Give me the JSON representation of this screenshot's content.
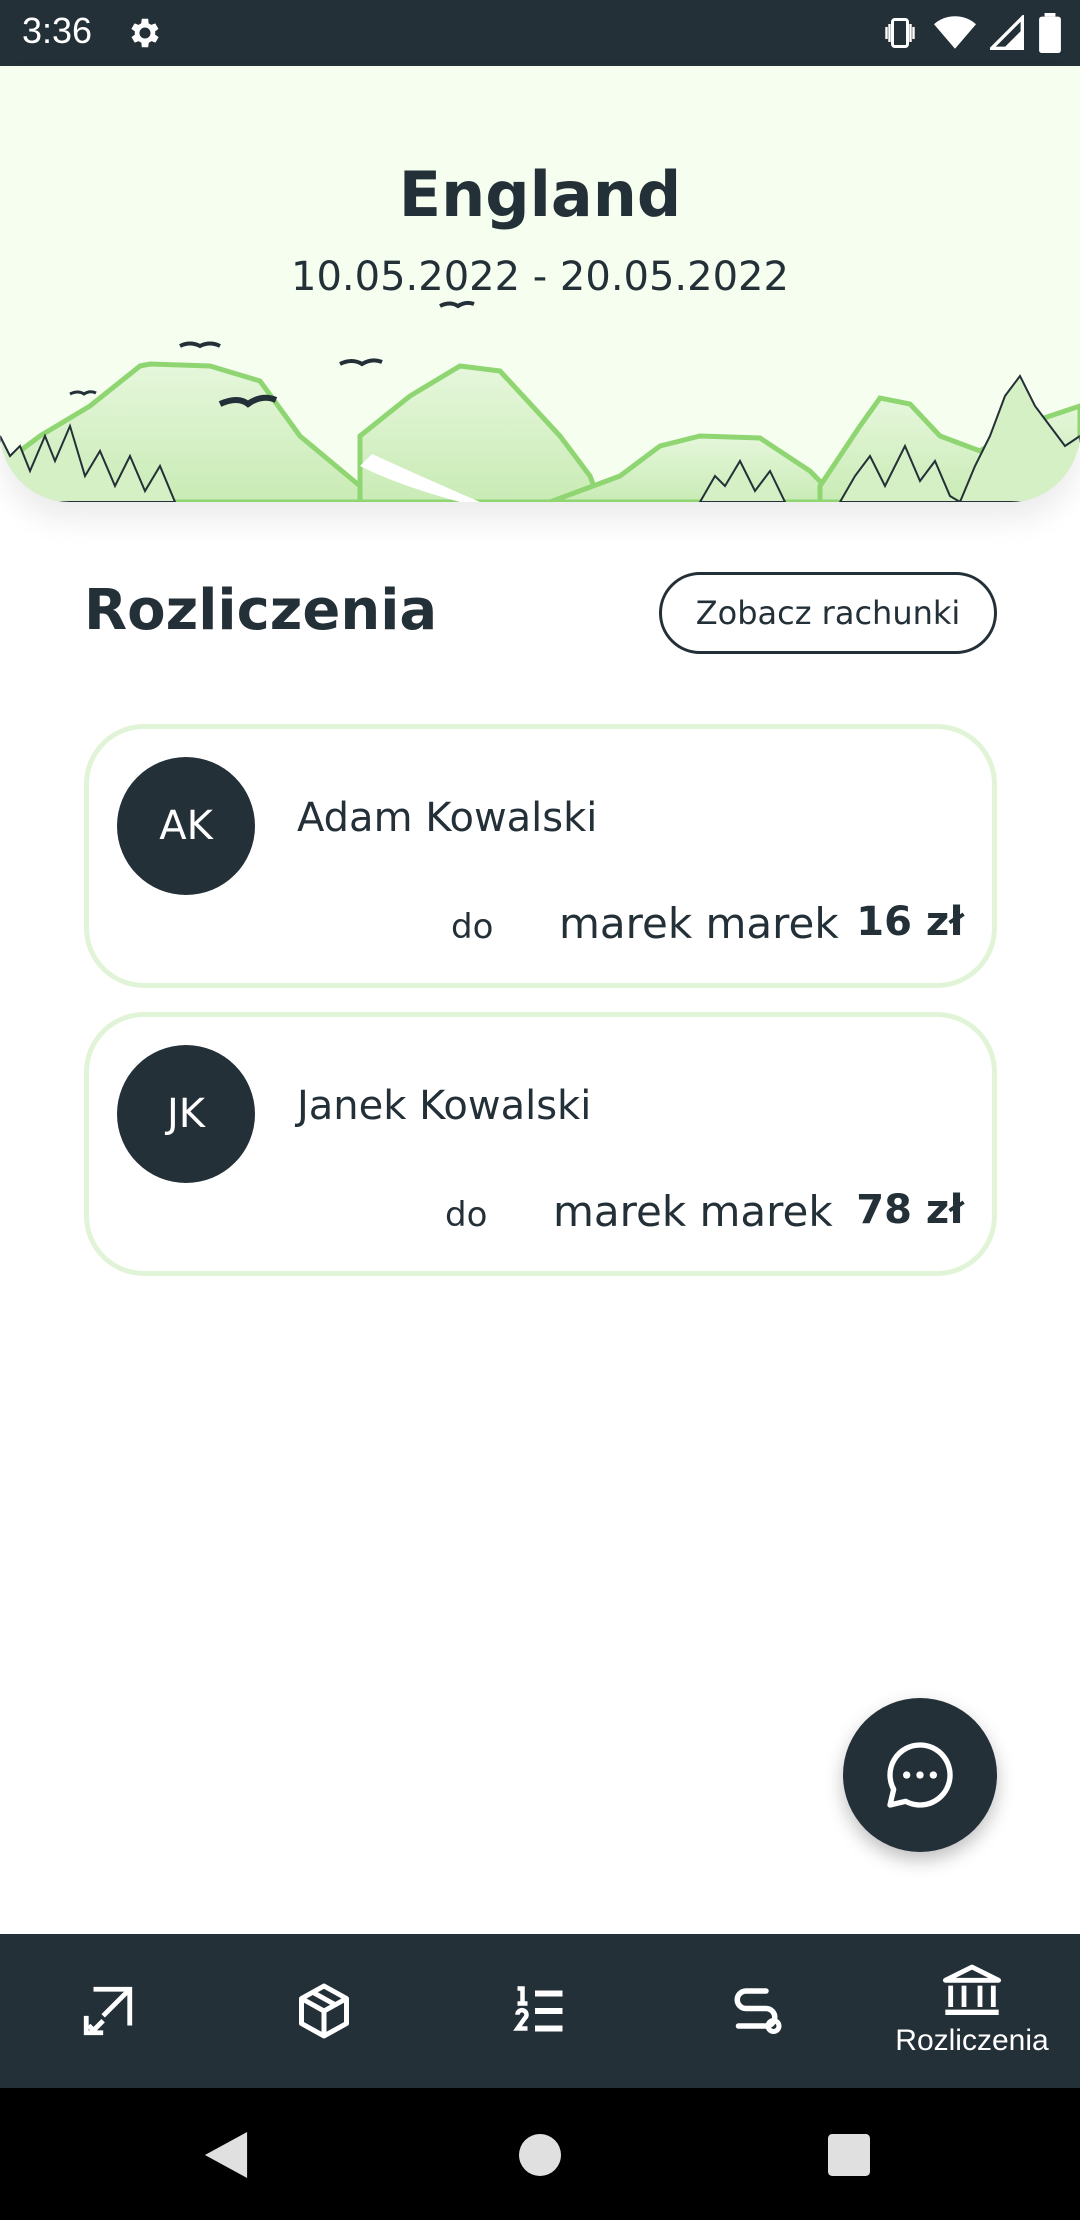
{
  "status_bar": {
    "time": "3:36"
  },
  "header": {
    "title": "England",
    "dates": "10.05.2022 - 20.05.2022"
  },
  "section": {
    "title": "Rozliczenia",
    "bills_button": "Zobacz rachunki"
  },
  "settlements": [
    {
      "initials": "AK",
      "name": "Adam Kowalski",
      "to_label": "do",
      "recipient": "marek marek",
      "amount": "16 zł"
    },
    {
      "initials": "JK",
      "name": "Janek Kowalski",
      "to_label": "do",
      "recipient": "marek marek",
      "amount": "78 zł"
    }
  ],
  "bottom_nav": {
    "items": [
      {
        "icon": "checklist-icon"
      },
      {
        "icon": "package-icon"
      },
      {
        "icon": "numbered-list-icon"
      },
      {
        "icon": "route-icon"
      },
      {
        "icon": "bank-icon",
        "label": "Rozliczenia",
        "active": true
      }
    ]
  },
  "colors": {
    "primary": "#243038",
    "card_border": "#e2f4d8",
    "header_bg": "#f6fef0",
    "mountain_green": "#8fd672"
  }
}
